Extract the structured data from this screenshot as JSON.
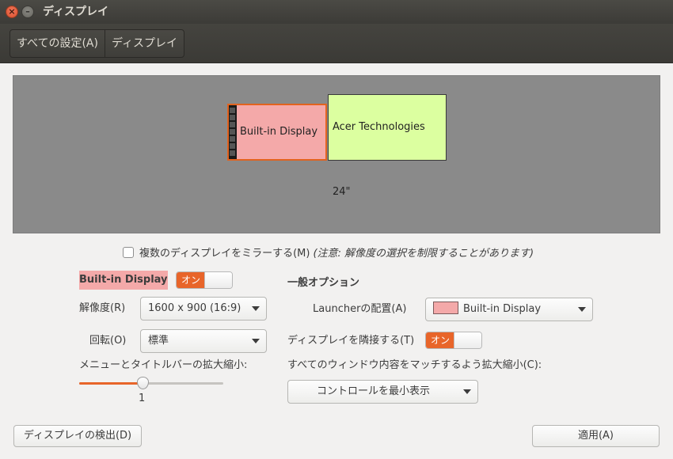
{
  "window": {
    "title": "ディスプレイ"
  },
  "breadcrumb": {
    "items": [
      "すべての設定(A)",
      "ディスプレイ"
    ]
  },
  "monitors": {
    "builtin_label": "Built-in Display",
    "acer_label": "Acer Technologies 24\""
  },
  "mirror": {
    "label": "複数のディスプレイをミラーする(M)",
    "note": "(注意: 解像度の選択を制限することがあります)",
    "checked": false
  },
  "display_panel": {
    "name": "Built-in Display",
    "power_toggle": "オン",
    "resolution_label": "解像度(R)",
    "resolution_value": "1600 x 900 (16:9)",
    "rotation_label": "回転(O)",
    "rotation_value": "標準",
    "scale_label": "メニューとタイトルバーの拡大縮小:",
    "scale_value": "1"
  },
  "general": {
    "title": "一般オプション",
    "launcher_label": "Launcherの配置(A)",
    "launcher_value": "Built-in Display",
    "sticky_label": "ディスプレイを隣接する(T)",
    "sticky_toggle": "オン",
    "scale_windows_label": "すべてのウィンドウ内容をマッチするよう拡大縮小(C):",
    "scale_windows_value": "コントロールを最小表示"
  },
  "buttons": {
    "detect": "ディスプレイの検出(D)",
    "apply": "適用(A)"
  },
  "colors": {
    "builtin_monitor": "#f4a9a9",
    "acer_monitor": "#dcffa0",
    "accent": "#e8652a"
  }
}
